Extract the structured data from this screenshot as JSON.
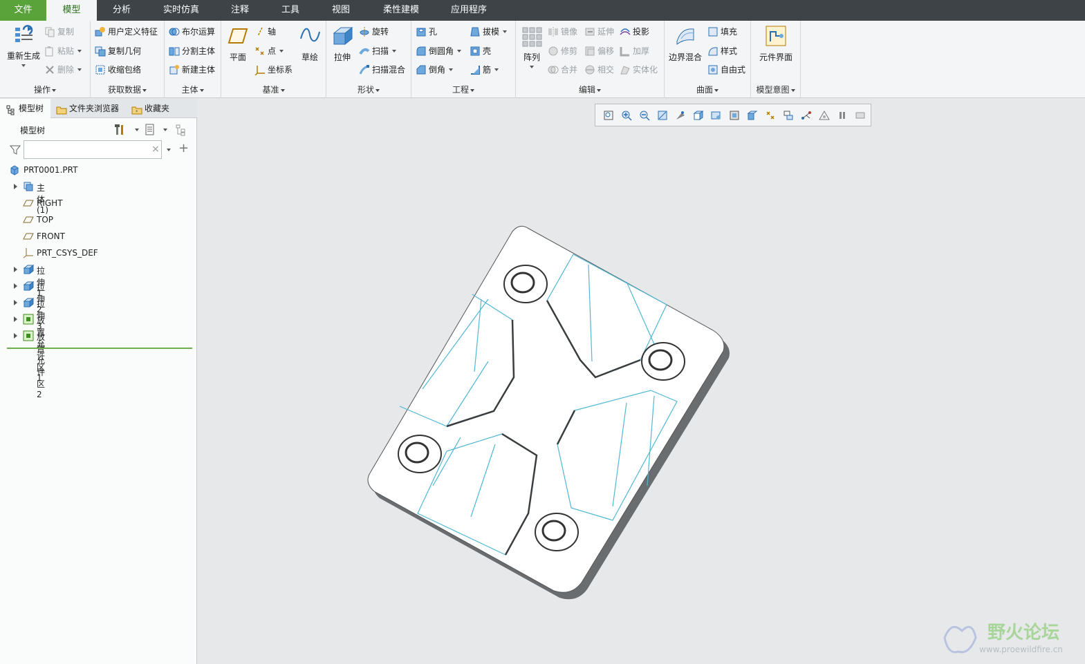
{
  "menu": {
    "tabs": [
      "文件",
      "模型",
      "分析",
      "实时仿真",
      "注释",
      "工具",
      "视图",
      "柔性建模",
      "应用程序"
    ],
    "active": "模型"
  },
  "ribbon": {
    "ops": {
      "label": "操作",
      "regen": "重新生成",
      "copy": "复制",
      "paste": "粘贴",
      "delete": "删除"
    },
    "getdata": {
      "label": "获取数据",
      "udf": "用户定义特征",
      "copygeom": "复制几何",
      "shrinkwrap": "收缩包络"
    },
    "body": {
      "label": "主体",
      "boolean": "布尔运算",
      "split": "分割主体",
      "newbody": "新建主体"
    },
    "datum": {
      "label": "基准",
      "plane": "平面",
      "axis": "轴",
      "point": "点",
      "csys": "坐标系",
      "sketch": "草绘"
    },
    "shapes": {
      "label": "形状",
      "extrude": "拉伸",
      "revolve": "旋转",
      "sweep": "扫描",
      "sweptblend": "扫描混合"
    },
    "engineering": {
      "label": "工程",
      "hole": "孔",
      "round": "倒圆角",
      "chamfer": "倒角",
      "draft": "拔模",
      "shell": "壳",
      "rib": "筋"
    },
    "editing": {
      "label": "编辑",
      "pattern": "阵列",
      "mirror": "镜像",
      "extend": "延伸",
      "project": "投影",
      "trim": "修剪",
      "offset": "偏移",
      "thicken": "加厚",
      "merge": "合并",
      "intersect": "相交",
      "solidify": "实体化"
    },
    "surfaces": {
      "label": "曲面",
      "boundary": "边界混合",
      "fill": "填充",
      "style": "样式",
      "freestyle": "自由式"
    },
    "intent": {
      "label": "模型意图",
      "component_interface": "元件界面"
    }
  },
  "panel": {
    "tabs": [
      "模型树",
      "文件夹浏览器",
      "收藏夹"
    ],
    "tree_title": "模型树",
    "search_placeholder": "",
    "items": [
      {
        "label": "PRT0001.PRT",
        "icon": "part-icon",
        "expandable": false,
        "indent": 0
      },
      {
        "label": "主体 (1)",
        "icon": "body-icon",
        "expandable": true,
        "indent": 1
      },
      {
        "label": "RIGHT",
        "icon": "datum-plane-icon",
        "expandable": false,
        "indent": 1
      },
      {
        "label": "TOP",
        "icon": "datum-plane-icon",
        "expandable": false,
        "indent": 1
      },
      {
        "label": "FRONT",
        "icon": "datum-plane-icon",
        "expandable": false,
        "indent": 1
      },
      {
        "label": "PRT_CSYS_DEF",
        "icon": "csys-icon",
        "expandable": false,
        "indent": 1
      },
      {
        "label": "拉伸 1",
        "icon": "extrude-icon",
        "expandable": true,
        "indent": 1
      },
      {
        "label": "拉伸 2",
        "icon": "extrude-icon",
        "expandable": true,
        "indent": 1
      },
      {
        "label": "拉伸 3",
        "icon": "extrude-icon",
        "expandable": true,
        "indent": 1
      },
      {
        "label": "放置允许区 1",
        "icon": "placement-zone-icon",
        "expandable": true,
        "indent": 1
      },
      {
        "label": "放置允许区 2",
        "icon": "placement-zone-icon",
        "expandable": true,
        "indent": 1
      }
    ]
  },
  "watermark": {
    "title": "野火论坛",
    "url": "www.proewildfire.cn"
  },
  "colors": {
    "menubar": "#3d4347",
    "file_tab": "#5aa33a",
    "accent_line": "#6ab04c",
    "model_edge": "#4fb8d6"
  }
}
